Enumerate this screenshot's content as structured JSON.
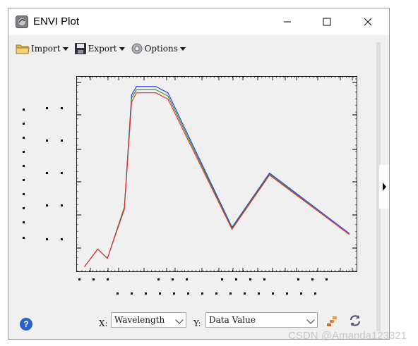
{
  "window": {
    "title": "ENVI Plot"
  },
  "toolbar": {
    "import_label": "Import",
    "export_label": "Export",
    "options_label": "Options"
  },
  "axis": {
    "x_label": "X:",
    "y_label": "Y:",
    "x_value": "Wavelength",
    "y_value": "Data Value"
  },
  "watermark": "CSDN @Amanda123321",
  "colors": {
    "series_blue": "#1a35ff",
    "series_green": "#1a9a1a",
    "series_red": "#ff2222"
  },
  "chart_data": {
    "type": "line",
    "title": "",
    "xlabel": "",
    "ylabel": "",
    "grid": false,
    "series": [
      {
        "color": "#1a35ff",
        "x": [
          0.05,
          0.16,
          0.24,
          0.38,
          0.44,
          0.48,
          0.64,
          0.74,
          1.27,
          1.58,
          2.24
        ],
        "y": [
          0.05,
          0.22,
          0.13,
          0.62,
          1.7,
          1.78,
          1.78,
          1.72,
          0.43,
          0.95,
          0.37
        ]
      },
      {
        "color": "#1a9a1a",
        "x": [
          0.05,
          0.16,
          0.24,
          0.38,
          0.44,
          0.48,
          0.64,
          0.74,
          1.27,
          1.58,
          2.24
        ],
        "y": [
          0.05,
          0.22,
          0.13,
          0.62,
          1.67,
          1.75,
          1.75,
          1.69,
          0.42,
          0.94,
          0.36
        ]
      },
      {
        "color": "#ff2222",
        "x": [
          0.05,
          0.16,
          0.24,
          0.38,
          0.44,
          0.48,
          0.64,
          0.74,
          1.27,
          1.58,
          2.24
        ],
        "y": [
          0.05,
          0.22,
          0.13,
          0.6,
          1.63,
          1.72,
          1.72,
          1.66,
          0.41,
          0.93,
          0.36
        ]
      }
    ],
    "xlim": [
      0,
      2.3
    ],
    "ylim": [
      0,
      1.86
    ]
  }
}
